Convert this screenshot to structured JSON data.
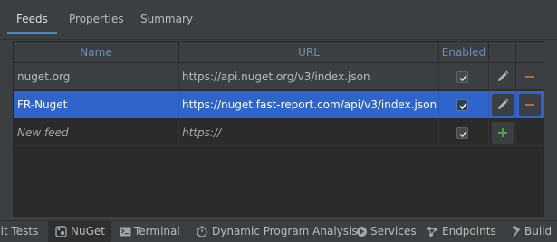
{
  "tabs": [
    {
      "label": "Feeds"
    },
    {
      "label": "Properties"
    },
    {
      "label": "Summary"
    }
  ],
  "table": {
    "columns": {
      "name": "Name",
      "url": "URL",
      "enabled": "Enabled"
    },
    "rows": [
      {
        "name": "nuget.org",
        "url": "https://api.nuget.org/v3/index.json",
        "enabled": true,
        "selected": false
      },
      {
        "name": "FR-Nuget",
        "url": "https://nuget.fast-report.com/api/v3/index.json",
        "enabled": true,
        "selected": true
      },
      {
        "name": "New feed",
        "url": "https://",
        "enabled": true,
        "selected": false
      }
    ]
  },
  "icons": {
    "edit": "pencil-icon",
    "remove": "minus-icon",
    "add": "plus-icon",
    "checkbox": "checkmark-icon"
  },
  "statusbar": {
    "unit_tests": "nit Tests",
    "nuget": "NuGet",
    "terminal": "Terminal",
    "dpa": "Dynamic Program Analysis",
    "services": "Services",
    "endpoints": "Endpoints",
    "build": "Build"
  },
  "colors": {
    "accent": "#4a88c7",
    "selection": "#2f65ca",
    "remove": "#b4683f",
    "add": "#5a9e4f",
    "header_text": "#6f8fb6"
  }
}
